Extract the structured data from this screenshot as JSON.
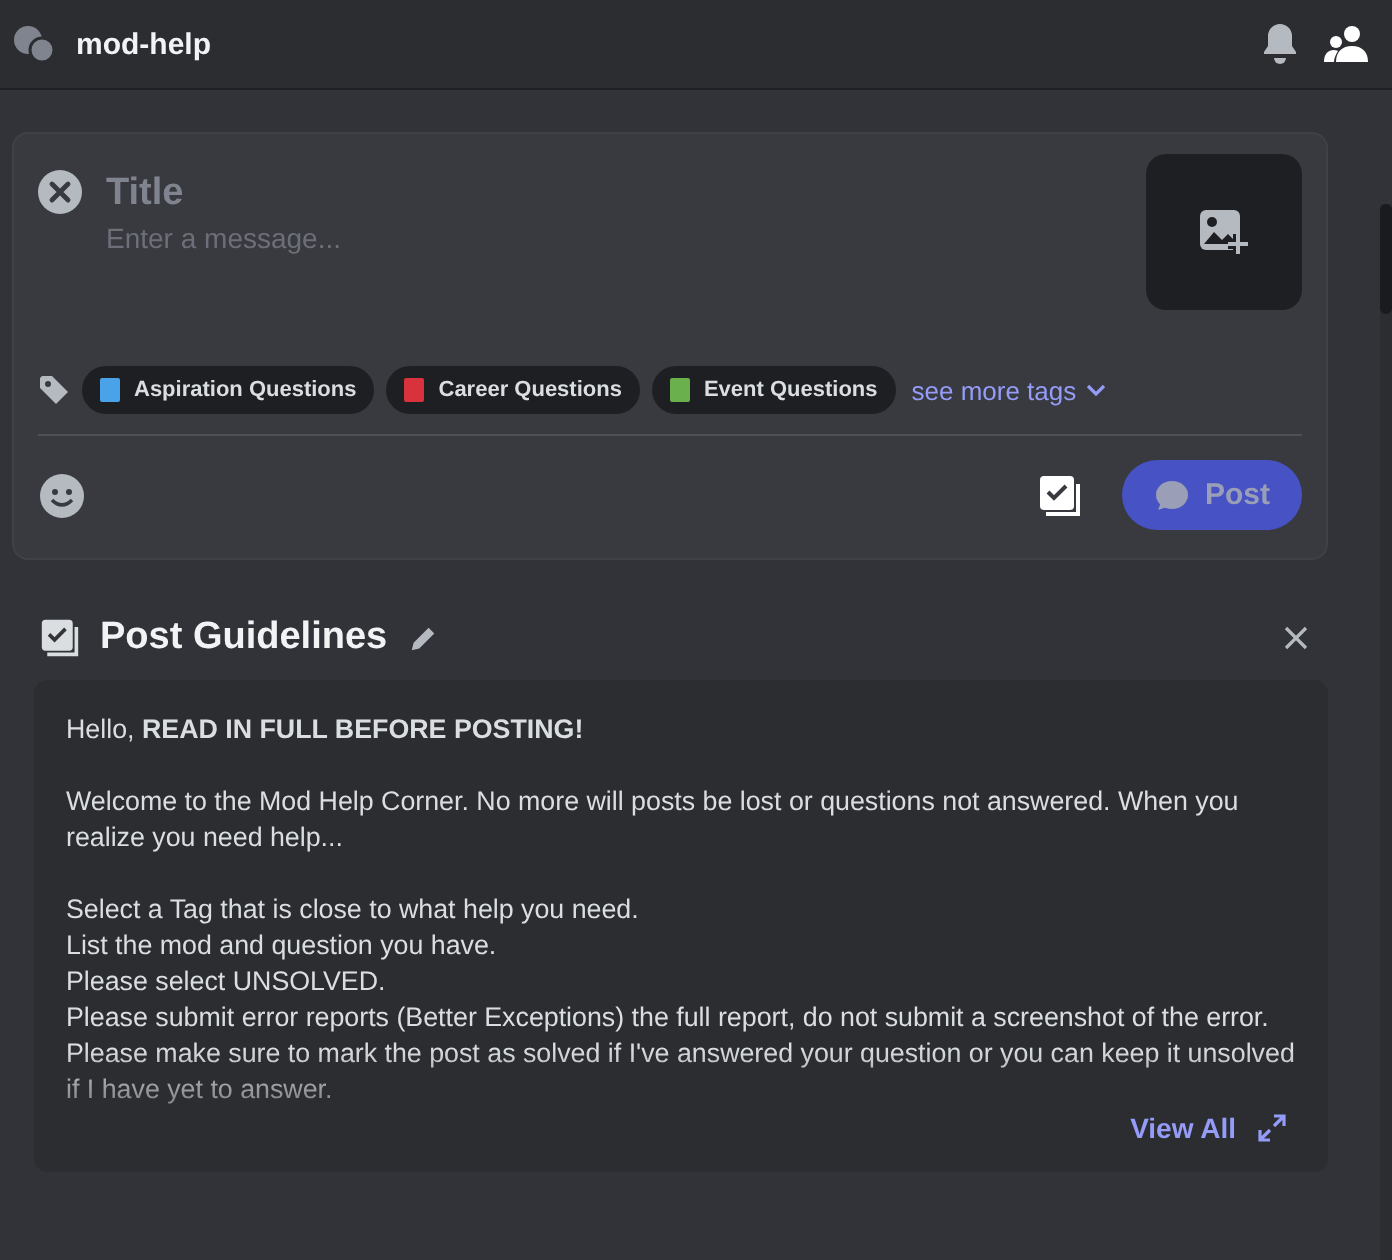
{
  "header": {
    "channel": "mod-help"
  },
  "composer": {
    "title_placeholder": "Title",
    "message_placeholder": "Enter a message...",
    "tags": [
      {
        "label": "Aspiration Questions",
        "color": "#4aa3e8"
      },
      {
        "label": "Career Questions",
        "color": "#d8323c"
      },
      {
        "label": "Event Questions",
        "color": "#6ab04c"
      }
    ],
    "more_tags": "see more tags",
    "post_button": "Post"
  },
  "guidelines": {
    "title": "Post Guidelines",
    "paragraphs": [
      "Hello, **READ IN FULL BEFORE POSTING!**",
      "Welcome to the Mod Help Corner. No more will posts be lost or questions not answered. When you realize you need help...",
      "Select a Tag that is close to what help you need.\nList the mod and question you have.\nPlease select UNSOLVED.\nPlease submit error reports (Better Exceptions) the full report, do not submit a screenshot of the error. Please make sure to mark the post as solved if I've answered your question or you can keep it unsolved if I have yet to answer."
    ],
    "view_all": "View All"
  }
}
